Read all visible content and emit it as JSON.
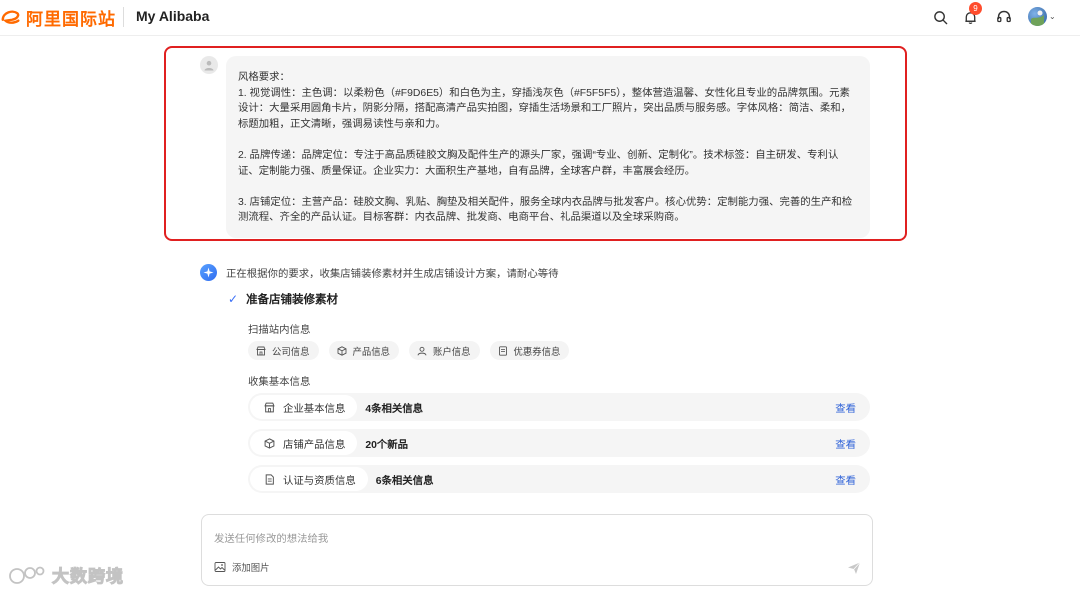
{
  "header": {
    "logo_mark": "ℯ",
    "logo_text": "阿里国际站",
    "site_title": "My Alibaba",
    "notification_count": "9",
    "icons": [
      "search-icon",
      "bell-icon",
      "headset-icon",
      "avatar"
    ],
    "brand_color": "#ff6a00"
  },
  "user_message": {
    "line_1": "风格要求：",
    "para_1": "1. 视觉调性：主色调：以柔粉色（#F9D6E5）和白色为主，穿插浅灰色（#F5F5F5），整体营造温馨、女性化且专业的品牌氛围。元素设计：大量采用圆角卡片，阴影分隔，搭配高清产品实拍图，穿插生活场景和工厂照片，突出品质与服务感。字体风格：简洁、柔和，标题加粗，正文清晰，强调易读性与亲和力。",
    "para_2": "2. 品牌传递：品牌定位：专注于高品质硅胶文胸及配件生产的源头厂家，强调“专业、创新、定制化”。技术标签：自主研发、专利认证、定制能力强、质量保证。企业实力：大面积生产基地，自有品牌，全球客户群，丰富展会经历。",
    "para_3": "3. 店铺定位：主营产品：硅胶文胸、乳贴、胸垫及相关配件，服务全球内衣品牌与批发客户。核心优势：定制能力强、完善的生产和检测流程、齐全的产品认证。目标客群：内衣品牌、批发商、电商平台、礼品渠道以及全球采购商。"
  },
  "assistant": {
    "status_text": "正在根据你的要求，收集店铺装修素材并生成店铺设计方案，请耐心等待",
    "step_title": "准备店铺装修素材",
    "scan_label": "扫描站内信息",
    "scan_chips": [
      {
        "label": "公司信息",
        "icon": "store-icon"
      },
      {
        "label": "产品信息",
        "icon": "box-icon"
      },
      {
        "label": "账户信息",
        "icon": "user-icon"
      },
      {
        "label": "优惠券信息",
        "icon": "coupon-icon"
      }
    ],
    "collect_label": "收集基本信息",
    "collect_rows": [
      {
        "label": "企业基本信息",
        "value": "4条相关信息",
        "link": "查看",
        "icon": "store-icon"
      },
      {
        "label": "店铺产品信息",
        "value": "20个新品",
        "link": "查看",
        "icon": "box-icon"
      },
      {
        "label": "认证与资质信息",
        "value": "6条相关信息",
        "link": "查看",
        "icon": "document-icon"
      }
    ]
  },
  "composer": {
    "placeholder": "发送任何修改的想法给我",
    "add_image_label": "添加图片"
  },
  "watermark": {
    "text": "大数跨境"
  }
}
